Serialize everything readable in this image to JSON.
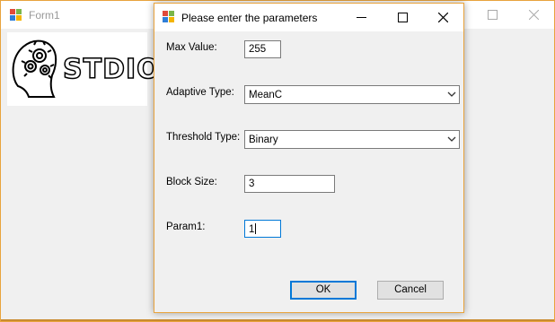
{
  "main_window": {
    "title": "Form1",
    "logo_text": "STDIO"
  },
  "dialog": {
    "title": "Please enter the parameters",
    "fields": {
      "max_value": {
        "label": "Max Value:",
        "value": "255"
      },
      "adaptive_type": {
        "label": "Adaptive Type:",
        "value": "MeanC"
      },
      "threshold_type": {
        "label": "Threshold Type:",
        "value": "Binary"
      },
      "block_size": {
        "label": "Block Size:",
        "value": "3"
      },
      "param1": {
        "label": "Param1:",
        "value": "1"
      }
    },
    "buttons": {
      "ok": "OK",
      "cancel": "Cancel"
    }
  },
  "icons": {
    "app": "windows-form-icon",
    "minimize": "minimize-icon",
    "maximize": "maximize-icon",
    "close": "close-icon",
    "dropdown": "chevron-down-icon"
  },
  "colors": {
    "window_border": "#e8a33d",
    "focus_border": "#0078d7",
    "button_face": "#e1e1e1"
  }
}
